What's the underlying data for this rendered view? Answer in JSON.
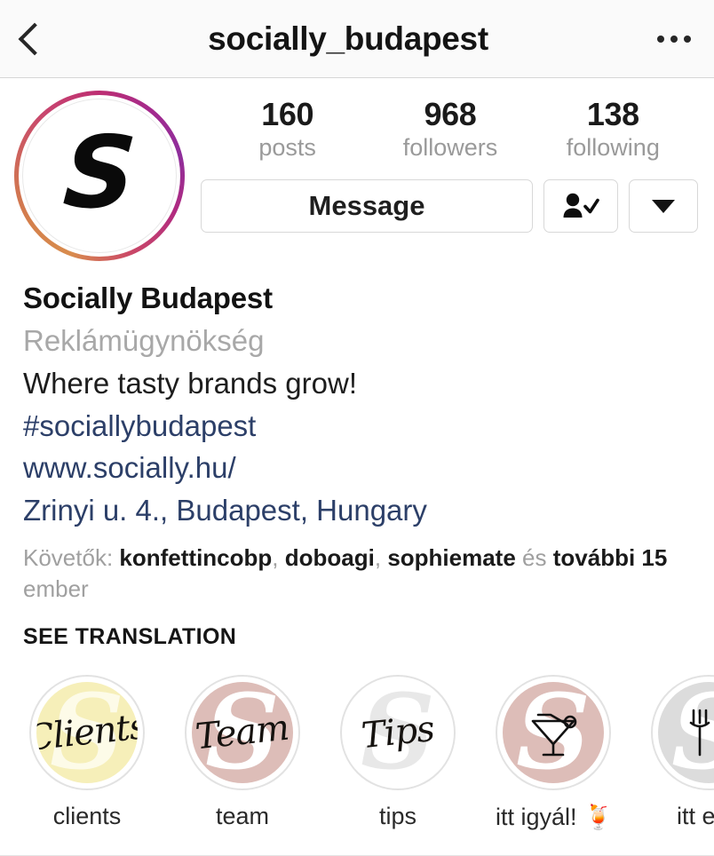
{
  "header": {
    "back_icon": "chevron-left-icon",
    "title": "socially_budapest",
    "more_icon": "more-options-icon"
  },
  "profile": {
    "avatar_letter": "S",
    "avatar_has_story_ring": true,
    "story_ring_colors": [
      "#d88c4e",
      "#c8456f",
      "#8e2e9c"
    ],
    "stats": [
      {
        "number": "160",
        "label": "posts"
      },
      {
        "number": "968",
        "label": "followers"
      },
      {
        "number": "138",
        "label": "following"
      }
    ],
    "buttons": {
      "message_label": "Message",
      "following_icon": "person-check-icon",
      "dropdown_icon": "chevron-down-icon"
    }
  },
  "bio": {
    "name": "Socially Budapest",
    "category": "Reklámügynökség",
    "description": "Where tasty brands grow!",
    "hashtag": "#sociallybudapest",
    "website": "www.socially.hu/",
    "address": "Zrinyi u. 4., Budapest, Hungary",
    "link_color": "#2c3f68",
    "followed_by": {
      "prefix": "Követők:",
      "names": [
        "konfettincobp",
        "doboagi",
        "sophiemate"
      ],
      "conjunction": "és",
      "more_count": "további 15",
      "suffix": "ember"
    },
    "see_translation": "SEE TRANSLATION"
  },
  "highlights": [
    {
      "label": "clients",
      "script": "Clients",
      "bg": "#f6efb9",
      "watermark_color": "#fdfbe8",
      "icon": "none"
    },
    {
      "label": "team",
      "script": "Team",
      "bg": "#ddbdb8",
      "watermark_color": "#ffffff",
      "icon": "none"
    },
    {
      "label": "tips",
      "script": "Tips",
      "bg": "#ffffff",
      "watermark_color": "#e8e8e8",
      "icon": "none"
    },
    {
      "label": "itt igyál! 🍹",
      "script": "",
      "bg": "#ddbdb8",
      "watermark_color": "#ffffff",
      "icon": "cocktail-icon"
    },
    {
      "label": "itt egy",
      "script": "",
      "bg": "#dcdcdc",
      "watermark_color": "#ffffff",
      "icon": "fork-knife-icon"
    }
  ]
}
